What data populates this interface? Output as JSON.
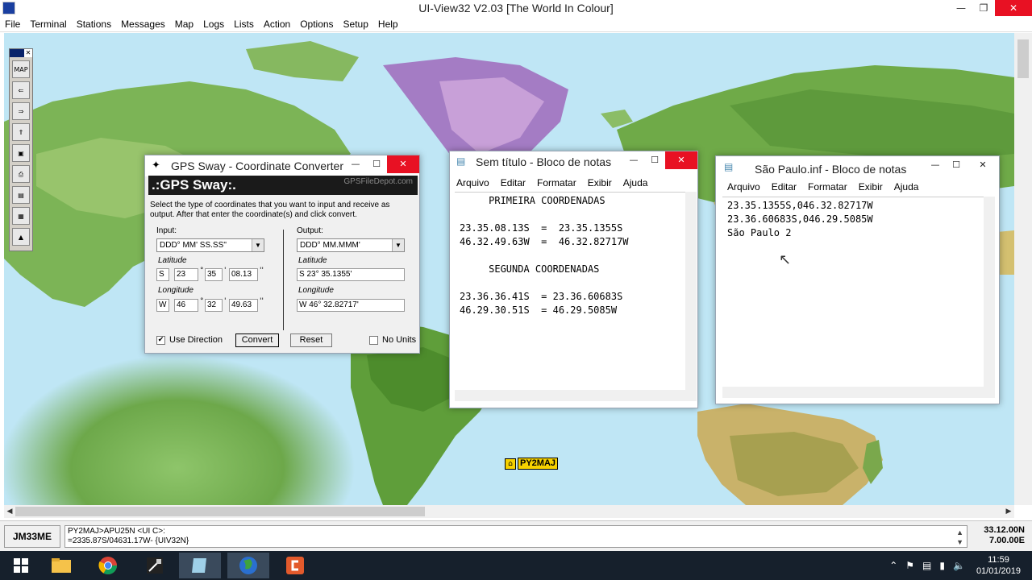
{
  "app": {
    "title": "UI-View32 V2.03 [The World In Colour]",
    "menu": [
      "File",
      "Terminal",
      "Stations",
      "Messages",
      "Map",
      "Logs",
      "Lists",
      "Action",
      "Options",
      "Setup",
      "Help"
    ]
  },
  "station": {
    "callsign": "PY2MAJ"
  },
  "status": {
    "locator": "JM33ME",
    "packet_line1": "PY2MAJ>APU25N <UI C>:",
    "packet_line2": "=2335.87S/04631.17W- {UIV32N}",
    "lat": "33.12.00N",
    "lon": "7.00.00E"
  },
  "gps_sway": {
    "window_title": "GPS Sway - Coordinate Converter",
    "banner": ".:GPS Sway:.",
    "depot": "GPSFileDepot.com",
    "description": "Select the type of coordinates that you want to input and receive as output.  After that enter the coordinate(s) and click convert.",
    "input_label": "Input:",
    "input_format": "DDD° MM' SS.SS''",
    "output_label": "Output:",
    "output_format": "DDD° MM.MMM'",
    "latitude_label": "Latitude",
    "longitude_label": "Longitude",
    "lat_dir": "S",
    "lat_deg": "23",
    "lat_min": "35",
    "lat_sec": "08.13",
    "lon_dir": "W",
    "lon_deg": "46",
    "lon_min": "32",
    "lon_sec": "49.63",
    "out_lat": "S 23° 35.1355'",
    "out_lon": "W 46° 32.82717'",
    "use_direction": "Use Direction",
    "use_direction_checked": "✔",
    "convert": "Convert",
    "reset": "Reset",
    "no_units": "No Units"
  },
  "notepad1": {
    "title": "Sem título - Bloco de notas",
    "menu": [
      "Arquivo",
      "Editar",
      "Formatar",
      "Exibir",
      "Ajuda"
    ],
    "content": "     PRIMEIRA COORDENADAS\n\n23.35.08.13S  =  23.35.1355S\n46.32.49.63W  =  46.32.82717W\n\n     SEGUNDA COORDENADAS\n\n23.36.36.41S  = 23.36.60683S\n46.29.30.51S  = 46.29.5085W"
  },
  "notepad2": {
    "title": "São Paulo.inf - Bloco de notas",
    "menu": [
      "Arquivo",
      "Editar",
      "Formatar",
      "Exibir",
      "Ajuda"
    ],
    "content": "23.35.1355S,046.32.82717W\n23.36.60683S,046.29.5085W\nSão Paulo 2"
  },
  "taskbar": {
    "time": "11:59",
    "date": "01/01/2019"
  }
}
